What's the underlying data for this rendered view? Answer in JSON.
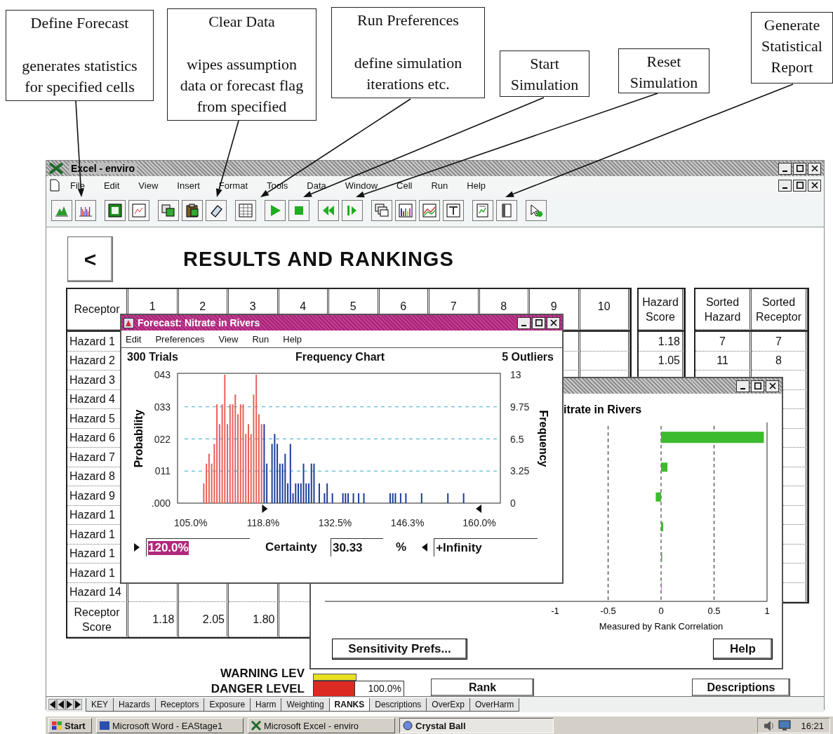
{
  "callouts": [
    {
      "title": "Define Forecast",
      "text": "generates statistics for specified cells"
    },
    {
      "title": "Clear Data",
      "text": "wipes assumption data or forecast flag from specified"
    },
    {
      "title": "Run Preferences",
      "text": "define simulation iterations etc."
    },
    {
      "title": "Start Simulation"
    },
    {
      "title": "Reset Simulation"
    },
    {
      "title": "Generate Statistical Report"
    }
  ],
  "excel": {
    "title": "Excel - enviro",
    "menu": [
      "File",
      "Edit",
      "View",
      "Insert",
      "Format",
      "Tools",
      "Data",
      "Window",
      "Cell",
      "Run",
      "Help"
    ],
    "back_button": "<",
    "heading": "RESULTS AND RANKINGS",
    "table": {
      "corner": "Receptor",
      "columns": [
        "1",
        "2",
        "3",
        "4",
        "5",
        "6",
        "7",
        "8",
        "9",
        "10"
      ],
      "rows": [
        "Hazard 1",
        "Hazard 2",
        "Hazard 3",
        "Hazard 4",
        "Hazard 5",
        "Hazard 6",
        "Hazard 7",
        "Hazard 8",
        "Hazard 9",
        "Hazard 1",
        "Hazard 1",
        "Hazard 1",
        "Hazard 1",
        "Hazard 14"
      ],
      "score_label": "Receptor Score",
      "scores": [
        "1.18",
        "2.05",
        "1.80"
      ]
    },
    "hazard_score": {
      "header": "Hazard Score",
      "values": [
        "1.18",
        "1.05"
      ]
    },
    "sorted": [
      {
        "header": "Sorted Hazard",
        "values": [
          "7",
          "11"
        ]
      },
      {
        "header": "Sorted Receptor",
        "values": [
          "7",
          "8"
        ]
      }
    ],
    "levels": {
      "warning_label": "WARNING LEV",
      "danger_label": "DANGER LEVEL",
      "danger_reading": "100.0%"
    },
    "buttons": [
      "Rank",
      "Descriptions"
    ],
    "sheet_tabs": [
      {
        "label": "KEY",
        "selected": false
      },
      {
        "label": "Hazards",
        "selected": false
      },
      {
        "label": "Receptors",
        "selected": false
      },
      {
        "label": "Exposure",
        "selected": false
      },
      {
        "label": "Harm",
        "selected": false
      },
      {
        "label": "Weighting",
        "selected": false
      },
      {
        "label": "RANKS",
        "selected": true
      },
      {
        "label": "Descriptions",
        "selected": false
      },
      {
        "label": "OverExp",
        "selected": false
      },
      {
        "label": "OverHarm",
        "selected": false
      }
    ]
  },
  "forecast_window": {
    "title": "Forecast: Nitrate in Rivers",
    "menu": [
      "Edit",
      "Preferences",
      "View",
      "Run",
      "Help"
    ],
    "trials": "300 Trials",
    "outliers": "5 Outliers",
    "probability_label": "Probability",
    "probability_ticks": [
      "043",
      "033",
      "022",
      "011",
      ".000"
    ],
    "chart_data": {
      "type": "bar",
      "title": "Frequency Chart",
      "ylabel": "Frequency",
      "xlim": [
        102.5,
        164
      ],
      "ylim": [
        0,
        13
      ],
      "grid": true,
      "xticks": [
        {
          "value": 105,
          "label": "105.0%"
        },
        {
          "value": 118.8,
          "label": "118.8%"
        },
        {
          "value": 132.5,
          "label": "132.5%"
        },
        {
          "value": 146.3,
          "label": "146.3%"
        },
        {
          "value": 160,
          "label": "160.0%"
        }
      ],
      "yticks": [
        0,
        3.25,
        6.5,
        9.75,
        13
      ],
      "x": [
        107.5,
        108,
        108.5,
        109,
        109.5,
        110,
        110.5,
        111,
        111.5,
        112,
        112.5,
        113,
        113.5,
        114,
        114.5,
        115,
        115.5,
        116,
        116.5,
        117,
        117.5,
        118,
        118.5,
        119,
        119.5,
        120.5,
        121,
        121.5,
        122,
        122.5,
        123,
        123.5,
        124,
        124.5,
        125,
        125.5,
        126,
        126.5,
        127,
        127.5,
        128,
        128.5,
        129.5,
        130.5,
        131,
        132,
        134,
        134.5,
        135,
        136,
        137,
        138,
        143,
        143.5,
        144,
        145,
        146,
        149,
        154,
        157
      ],
      "series": [
        {
          "color": "#e8605a",
          "values": [
            2,
            4,
            5,
            4,
            6,
            10,
            8,
            10,
            13,
            8,
            10,
            10,
            11,
            9,
            10,
            10,
            7,
            8,
            7,
            11,
            13,
            9,
            8,
            null,
            null,
            null,
            null,
            null,
            null,
            null,
            null,
            null,
            null,
            null,
            null,
            null,
            null,
            null,
            null,
            null,
            null,
            null,
            null,
            null,
            null,
            null,
            null,
            null,
            null,
            null,
            null,
            null,
            null,
            null,
            null,
            null,
            null,
            null,
            null,
            null
          ]
        },
        {
          "color": "#1c3f9a",
          "values": [
            null,
            null,
            null,
            null,
            null,
            null,
            null,
            null,
            null,
            null,
            null,
            null,
            null,
            null,
            null,
            null,
            null,
            null,
            null,
            null,
            null,
            null,
            null,
            8,
            4,
            6,
            7,
            6,
            4,
            4,
            5,
            2,
            6,
            1,
            2,
            2,
            2,
            4,
            2,
            2,
            4,
            4,
            2,
            1,
            2,
            1,
            1,
            1,
            1,
            1,
            1,
            1,
            1,
            1,
            1,
            1,
            1,
            1,
            1,
            1
          ]
        }
      ]
    },
    "lower_bound": "120.0%",
    "certainty_label": "Certainty",
    "certainty": "30.33",
    "percent": "%",
    "upper_bound": "+Infinity"
  },
  "sensitivity_window": {
    "chart_data": {
      "type": "bar",
      "orientation": "horizontal",
      "title": "itrate in Rivers",
      "xlabel": "Measured by Rank Correlation",
      "xlim": [
        -1,
        1
      ],
      "xticks": [
        -1,
        -0.5,
        0,
        0.5,
        1
      ],
      "grid": true,
      "values": [
        0.97,
        0.06,
        -0.05,
        0.02,
        0.01,
        0.005
      ]
    },
    "buttons": [
      "Sensitivity Prefs...",
      "Help"
    ]
  },
  "taskbar": {
    "start": "Start",
    "tasks": [
      {
        "label": "Microsoft Word - EAStage1",
        "kind": "word",
        "selected": false
      },
      {
        "label": "Microsoft Excel - enviro",
        "kind": "excel",
        "selected": false
      },
      {
        "label": "Crystal Ball",
        "kind": "ball",
        "selected": true
      }
    ],
    "clock": "16:21"
  }
}
